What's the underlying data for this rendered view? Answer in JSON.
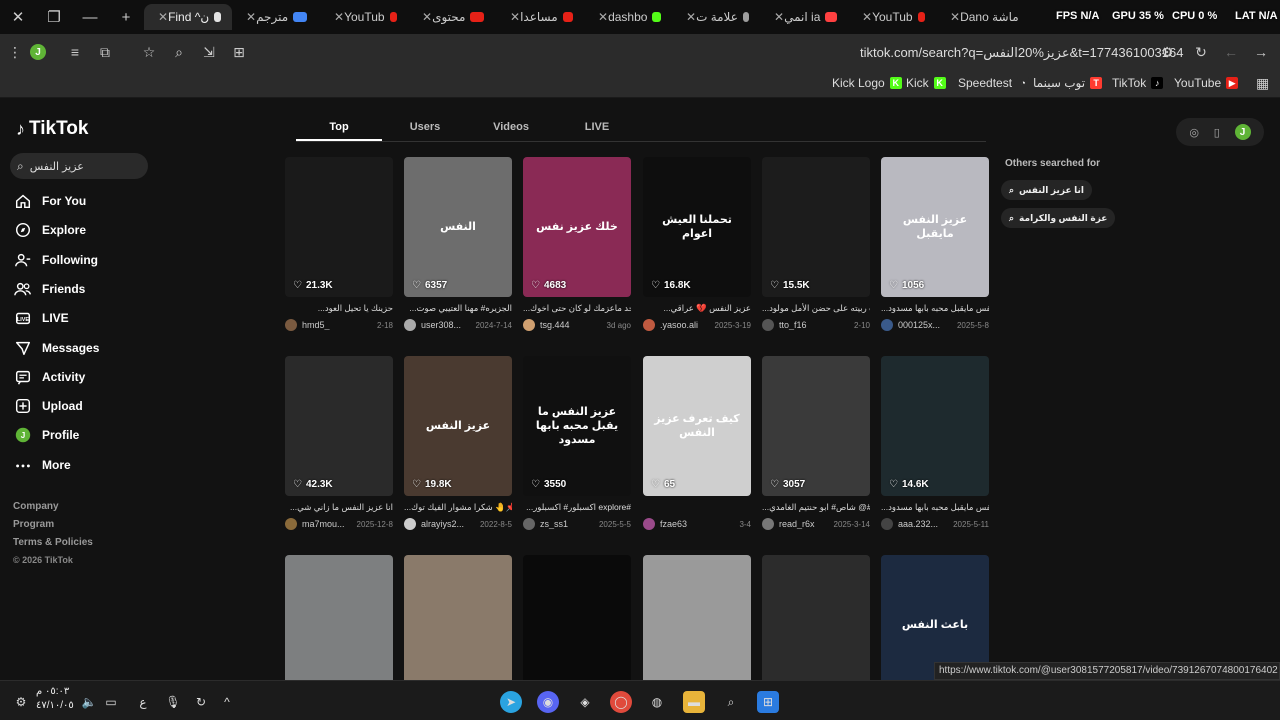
{
  "browser": {
    "tabs": [
      {
        "label": "Find ^ن",
        "color": "#e4e4e4",
        "active": true
      },
      {
        "label": "مترجم",
        "color": "#4285f4"
      },
      {
        "label": "YouTub",
        "color": "#e62117"
      },
      {
        "label": "محتوى",
        "color": "#e62117"
      },
      {
        "label": "مساعدا",
        "color": "#e62117"
      },
      {
        "label": "dashbo",
        "color": "#53fc18"
      },
      {
        "label": "علامة ت",
        "color": "#9e9e9e"
      },
      {
        "label": "انمي ia",
        "color": "#ff4040"
      },
      {
        "label": "YouTub",
        "color": "#e62117"
      },
      {
        "label": "Dano ماشة",
        "color": "#e62117"
      }
    ],
    "overlay": {
      "fps": "FPS N/A",
      "gpu": "GPU 35 %",
      "cpu": "CPU 0 %",
      "lat": "LAT N/A"
    },
    "url": "tiktok.com/search?q=عزيز%20النفس&t=1774361003164",
    "avatar_letter": "J",
    "bookmarks": [
      {
        "label": "Kick Logo",
        "icon": "K",
        "color": "#53fc18"
      },
      {
        "label": "Kick",
        "icon": "K",
        "color": "#53fc18"
      },
      {
        "label": "Speedtest",
        "icon": "◔",
        "color": "#2b2b2b"
      },
      {
        "label": "توب سينما",
        "icon": "T",
        "color": "#ff3b30"
      },
      {
        "label": "TikTok",
        "icon": "♪",
        "color": "#000000"
      },
      {
        "label": "YouTube",
        "icon": "▶",
        "color": "#e62117"
      }
    ]
  },
  "sidebar": {
    "logo": "TikTok",
    "search_query": "عزيز النفس",
    "items": [
      {
        "label": "For You",
        "icon": "home-icon"
      },
      {
        "label": "Explore",
        "icon": "compass-icon"
      },
      {
        "label": "Following",
        "icon": "following-icon"
      },
      {
        "label": "Friends",
        "icon": "friends-icon"
      },
      {
        "label": "LIVE",
        "icon": "live-icon"
      },
      {
        "label": "Messages",
        "icon": "messages-icon"
      },
      {
        "label": "Activity",
        "icon": "activity-icon"
      },
      {
        "label": "Upload",
        "icon": "upload-icon"
      },
      {
        "label": "Profile",
        "icon": "profile-icon"
      },
      {
        "label": "More",
        "icon": "more-icon"
      }
    ],
    "footer": [
      "Company",
      "Program",
      "Terms & Policies",
      "© 2026 TikTok"
    ]
  },
  "search_tabs": [
    "Top",
    "Users",
    "Videos",
    "LIVE"
  ],
  "right_panel": {
    "title": "Others searched for",
    "suggestions": [
      "انا عزيز النفس",
      "عزة النفس والكرامة"
    ]
  },
  "videos": [
    {
      "likes": "21.3K",
      "caption": "...حزينك يا تحيل العود",
      "user": "hmd5_",
      "date": "2-18",
      "thumb_text": "",
      "bg": "#1a1a1a",
      "av": "#7a5a40"
    },
    {
      "likes": "6357",
      "caption": "...الجزيره# مهنا العتيبي صوت",
      "user": "user308...",
      "date": "2024-7-14",
      "thumb_text": "النفس",
      "bg": "#6d6d6d",
      "av": "#aaaaaa"
    },
    {
      "likes": "4683",
      "caption": "...واحد ماعزمك لو كان حتى اخوك",
      "user": "tsg.444",
      "date": "3d ago",
      "thumb_text": "خلك عزيز نفس",
      "bg": "#8a2a55",
      "av": "#d0a070"
    },
    {
      "likes": "16.8K",
      "caption": "...عزيز النفس 💔 عراقي",
      "user": ".yasoo.ali",
      "date": "2025-3-19",
      "thumb_text": "تحملنا العيش اعوام",
      "bg": "#0e0e0e",
      "av": "#c05a40"
    },
    {
      "likes": "15.5K",
      "caption": "...ب ربيته على حضن الأمل مولود",
      "user": "tto_f16",
      "date": "2-10",
      "thumb_text": "",
      "bg": "#1c1c1c",
      "av": "#555555"
    },
    {
      "likes": "1056",
      "caption": "...يز النفس مايقبل محبه بابها مسدود",
      "user": "000125x...",
      "date": "2025-5-8",
      "thumb_text": "عزيز النفس مايقبل",
      "bg": "#b9b9c0",
      "av": "#3a5a8a"
    },
    {
      "likes": "42.3K",
      "caption": "...انا عزيز النفس ما زاني شي",
      "user": "ma7mou...",
      "date": "2025-12-8",
      "thumb_text": "",
      "bg": "#2a2a2a",
      "av": "#8a6a3a"
    },
    {
      "likes": "19.8K",
      "caption": "...شكرا مشوار الفيك توك 🤚📌",
      "user": "alrayiys2...",
      "date": "2022-8-5",
      "thumb_text": "عزيز النفس",
      "bg": "#4a3a30",
      "av": "#cccccc"
    },
    {
      "likes": "3550",
      "caption": "...اكسبلور# اكسبلور explore#",
      "user": "zs_ss1",
      "date": "2025-5-5",
      "thumb_text": "عزيز النفس ما يقبل محبه بابها مسدود",
      "bg": "#101010",
      "av": "#666666"
    },
    {
      "likes": "65",
      "caption": "",
      "user": "fzae63",
      "date": "3-4",
      "thumb_text": "كيف تعرف عزيز النفس",
      "bg": "#cfcfcf",
      "av": "#9a4a8a"
    },
    {
      "likes": "3057",
      "caption": "...شاص# ابو حنتيم الغامدي @#",
      "user": "read_r6x",
      "date": "2025-3-14",
      "thumb_text": "",
      "bg": "#3a3a3a",
      "av": "#777777"
    },
    {
      "likes": "14.6K",
      "caption": "...يز النفس مايقبل محبه بابها مسدود",
      "user": "aaa.232...",
      "date": "2025-5-11",
      "thumb_text": "",
      "bg": "#1e2a2e",
      "av": "#444444"
    },
    {
      "likes": "",
      "caption": "",
      "user": "",
      "date": "",
      "thumb_text": "",
      "bg": "#7d7f80",
      "av": "#000000"
    },
    {
      "likes": "",
      "caption": "",
      "user": "",
      "date": "",
      "thumb_text": "",
      "bg": "#8a7a6a",
      "av": "#000000"
    },
    {
      "likes": "",
      "caption": "",
      "user": "",
      "date": "",
      "thumb_text": "",
      "bg": "#0a0a0a",
      "av": "#000000"
    },
    {
      "likes": "",
      "caption": "",
      "user": "",
      "date": "",
      "thumb_text": "",
      "bg": "#9a9a9a",
      "av": "#000000"
    },
    {
      "likes": "",
      "caption": "",
      "user": "",
      "date": "",
      "thumb_text": "",
      "bg": "#2c2c2c",
      "av": "#000000"
    },
    {
      "likes": "",
      "caption": "",
      "user": "",
      "date": "",
      "thumb_text": "باعث النفس",
      "bg": "#1c2a40",
      "av": "#000000"
    }
  ],
  "status_url": "https://www.tiktok.com/@user3081577205817/video/7391267074800176402",
  "taskbar": {
    "time": "٠٥:٠٣ م",
    "date": "٤٧/١٠/٠٥",
    "lang": "ع"
  }
}
